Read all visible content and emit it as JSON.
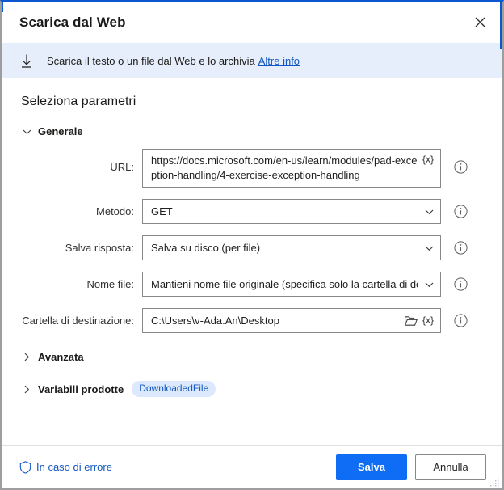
{
  "window": {
    "title": "Scarica dal Web",
    "close_label": "✕",
    "close_icon": "close-icon",
    "accent_color": "#0a57d0"
  },
  "banner": {
    "icon": "download-arrow-icon",
    "text": "Scarica il testo o un file dal Web e lo archivia",
    "link_label": "Altre info",
    "background": "#e7eefb",
    "link_color": "#1257c0"
  },
  "main": {
    "section_title": "Seleziona parametri",
    "groups": [
      {
        "id": "generale",
        "label": "Generale",
        "expanded": true,
        "chevron": "chevron-down-icon"
      },
      {
        "id": "avanzata",
        "label": "Avanzata",
        "expanded": false,
        "chevron": "chevron-right-icon"
      },
      {
        "id": "variabili-prodotte",
        "label": "Variabili prodotte",
        "expanded": false,
        "chevron": "chevron-right-icon",
        "badge": "DownloadedFile",
        "badge_bg": "#dce8fb",
        "badge_color": "#1257c0"
      }
    ],
    "fields": [
      {
        "id": "url",
        "label": "URL:",
        "type": "textarea",
        "value": "https://docs.microsoft.com/en-us/learn/modules/pad-exception-handling/4-exercise-exception-handling",
        "variable_token": "{x}",
        "info_icon": "info-icon"
      },
      {
        "id": "metodo",
        "label": "Metodo:",
        "type": "dropdown",
        "value": "GET",
        "caret": "chevron-down-icon",
        "info_icon": "info-icon"
      },
      {
        "id": "salva-risposta",
        "label": "Salva risposta:",
        "type": "dropdown",
        "value": "Salva su disco (per file)",
        "caret": "chevron-down-icon",
        "info_icon": "info-icon"
      },
      {
        "id": "nome-file",
        "label": "Nome file:",
        "type": "dropdown",
        "value": "Mantieni nome file originale (specifica solo la cartella di dest",
        "caret": "chevron-down-icon",
        "info_icon": "info-icon"
      },
      {
        "id": "cartella-destinazione",
        "label": "Cartella di destinazione:",
        "type": "folder",
        "value": "C:\\Users\\v-Ada.An\\Desktop",
        "folder_icon": "folder-open-icon",
        "variable_token": "{x}",
        "info_icon": "info-icon"
      }
    ]
  },
  "footer": {
    "on_error_label": "In caso di errore",
    "on_error_icon": "shield-icon",
    "on_error_color": "#1257c0",
    "save_label": "Salva",
    "cancel_label": "Annulla",
    "primary_color": "#0f6cf5",
    "resize_grip": "resize-grip-icon"
  }
}
